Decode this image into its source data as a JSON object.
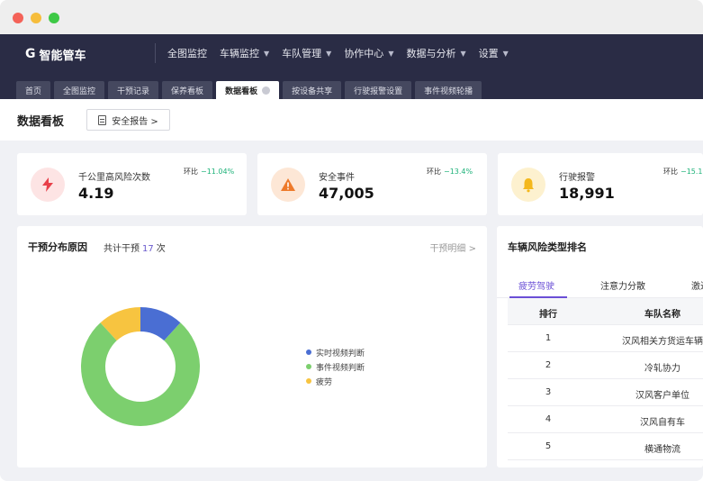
{
  "app": {
    "logo": "G",
    "name": "智能管车"
  },
  "menu": [
    {
      "label": "全图监控",
      "dropdown": false
    },
    {
      "label": "车辆监控",
      "dropdown": true
    },
    {
      "label": "车队管理",
      "dropdown": true
    },
    {
      "label": "协作中心",
      "dropdown": true
    },
    {
      "label": "数据与分析",
      "dropdown": true
    },
    {
      "label": "设置",
      "dropdown": true
    }
  ],
  "tabs": [
    {
      "label": "首页",
      "active": false
    },
    {
      "label": "全图监控",
      "active": false
    },
    {
      "label": "干预记录",
      "active": false
    },
    {
      "label": "保养看板",
      "active": false
    },
    {
      "label": "数据看板",
      "active": true
    },
    {
      "label": "按设备共享",
      "active": false
    },
    {
      "label": "行驶报警设置",
      "active": false
    },
    {
      "label": "事件视频轮播",
      "active": false
    }
  ],
  "page": {
    "title": "数据看板",
    "report_button": "安全报告 >"
  },
  "stats": [
    {
      "label": "千公里高风险次数",
      "value": "4.19",
      "trend_label": "环比",
      "trend_value": "−11.04%",
      "icon": "lightning-icon",
      "icon_color": "#e8404a",
      "icon_bg": "#fde4e4"
    },
    {
      "label": "安全事件",
      "value": "47,005",
      "trend_label": "环比",
      "trend_value": "−13.4%",
      "icon": "warning-icon",
      "icon_color": "#ee7a2a",
      "icon_bg": "#fde7d6"
    },
    {
      "label": "行驶报警",
      "value": "18,991",
      "trend_label": "环比",
      "trend_value": "−15.1",
      "icon": "bell-icon",
      "icon_color": "#f4b81c",
      "icon_bg": "#fdf1cf"
    }
  ],
  "intervention": {
    "title": "干预分布原因",
    "total_prefix": "共计干预",
    "total_count": "17",
    "total_suffix": "次",
    "detail_link": "干预明细 >"
  },
  "chart_data": {
    "type": "pie",
    "categories": [
      "实时视频判断",
      "事件视频判断",
      "疲劳"
    ],
    "values": [
      2,
      13,
      2
    ],
    "colors": [
      "#4a6ed3",
      "#7ccf6e",
      "#f7c440"
    ],
    "legend": "right"
  },
  "ranking": {
    "title": "车辆风险类型排名",
    "tabs": [
      "疲劳驾驶",
      "注意力分散",
      "激进"
    ],
    "columns": [
      "排行",
      "车队名称"
    ],
    "rows": [
      {
        "rank": "1",
        "name": "汉风相关方货运车辆"
      },
      {
        "rank": "2",
        "name": "冷轧协力"
      },
      {
        "rank": "3",
        "name": "汉风客户单位"
      },
      {
        "rank": "4",
        "name": "汉风自有车"
      },
      {
        "rank": "5",
        "name": "横通物流"
      }
    ]
  }
}
